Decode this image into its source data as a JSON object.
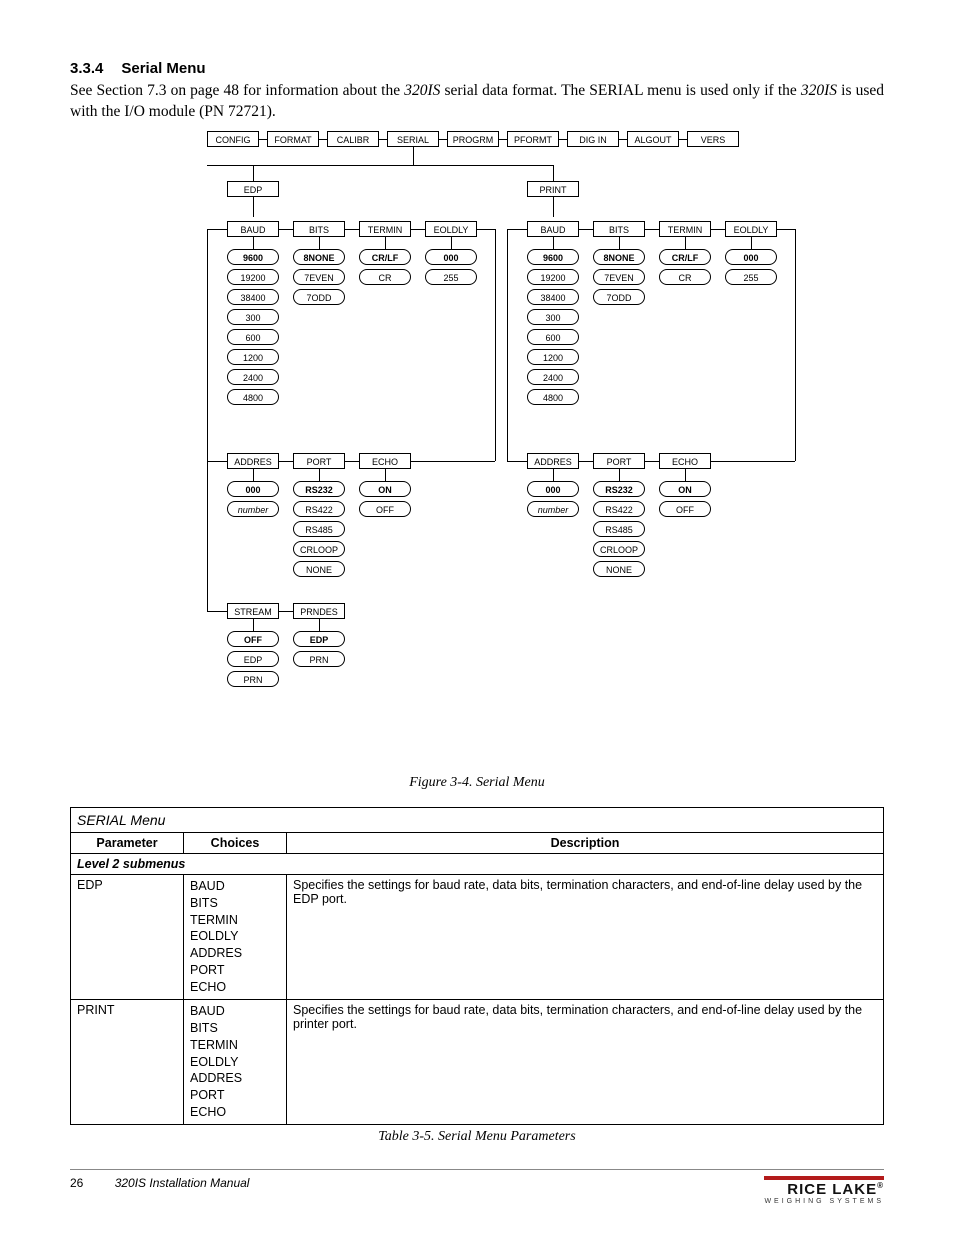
{
  "heading": {
    "num": "3.3.4",
    "title": "Serial Menu"
  },
  "intro": {
    "line1_a": "See Section 7.3 on page 48 for information about the ",
    "line1_ital": "320IS",
    "line1_b": " serial data format. The SERIAL menu is used only if the ",
    "line2_ital": "320IS",
    "line1_c": " is used with the I/O module (PN 72721)."
  },
  "diagram": {
    "top_menu": [
      "CONFIG",
      "FORMAT",
      "CALIBR",
      "SERIAL",
      "PROGRM",
      "PFORMT",
      "DIG IN",
      "ALGOUT",
      "VERS"
    ],
    "midA": "EDP",
    "midB": "PRINT",
    "row2": [
      "BAUD",
      "BITS",
      "TERMIN",
      "EOLDLY"
    ],
    "baud_opts": [
      "9600",
      "19200",
      "38400",
      "300",
      "600",
      "1200",
      "2400",
      "4800"
    ],
    "bits_opts": [
      "8NONE",
      "7EVEN",
      "7ODD"
    ],
    "termin_opts": [
      "CR/LF",
      "CR"
    ],
    "eoldly_opts": [
      "000",
      "255"
    ],
    "row3": [
      "ADDRES",
      "PORT",
      "ECHO"
    ],
    "addres_opts": [
      "000",
      "number"
    ],
    "port_opts": [
      "RS232",
      "RS422",
      "RS485",
      "CRLOOP",
      "NONE"
    ],
    "echo_opts": [
      "ON",
      "OFF"
    ],
    "row4": [
      "STREAM",
      "PRNDES"
    ],
    "stream_opts": [
      "OFF",
      "EDP",
      "PRN"
    ],
    "prndes_opts": [
      "EDP",
      "PRN"
    ]
  },
  "fig_caption": "Figure 3-4. Serial Menu",
  "table": {
    "title": "SERIAL Menu",
    "headers": [
      "Parameter",
      "Choices",
      "Description"
    ],
    "section": "Level 2 submenus",
    "rows": [
      {
        "param": "EDP",
        "choices": [
          "BAUD",
          "BITS",
          "TERMIN",
          "EOLDLY",
          "ADDRES",
          "PORT",
          "ECHO"
        ],
        "desc": "Specifies the settings for baud rate, data bits, termination characters, and end-of-line delay used by the EDP port."
      },
      {
        "param": "PRINT",
        "choices": [
          "BAUD",
          "BITS",
          "TERMIN",
          "EOLDLY",
          "ADDRES",
          "PORT",
          "ECHO"
        ],
        "desc": "Specifies the settings for baud rate, data bits, termination characters, and end-of-line delay used by the printer port."
      }
    ]
  },
  "table_caption": "Table 3-5. Serial Menu Parameters",
  "footer": {
    "page": "26",
    "doc": "320IS Installation Manual",
    "brand": "RICE LAKE",
    "brand_sub": "WEIGHING SYSTEMS"
  }
}
